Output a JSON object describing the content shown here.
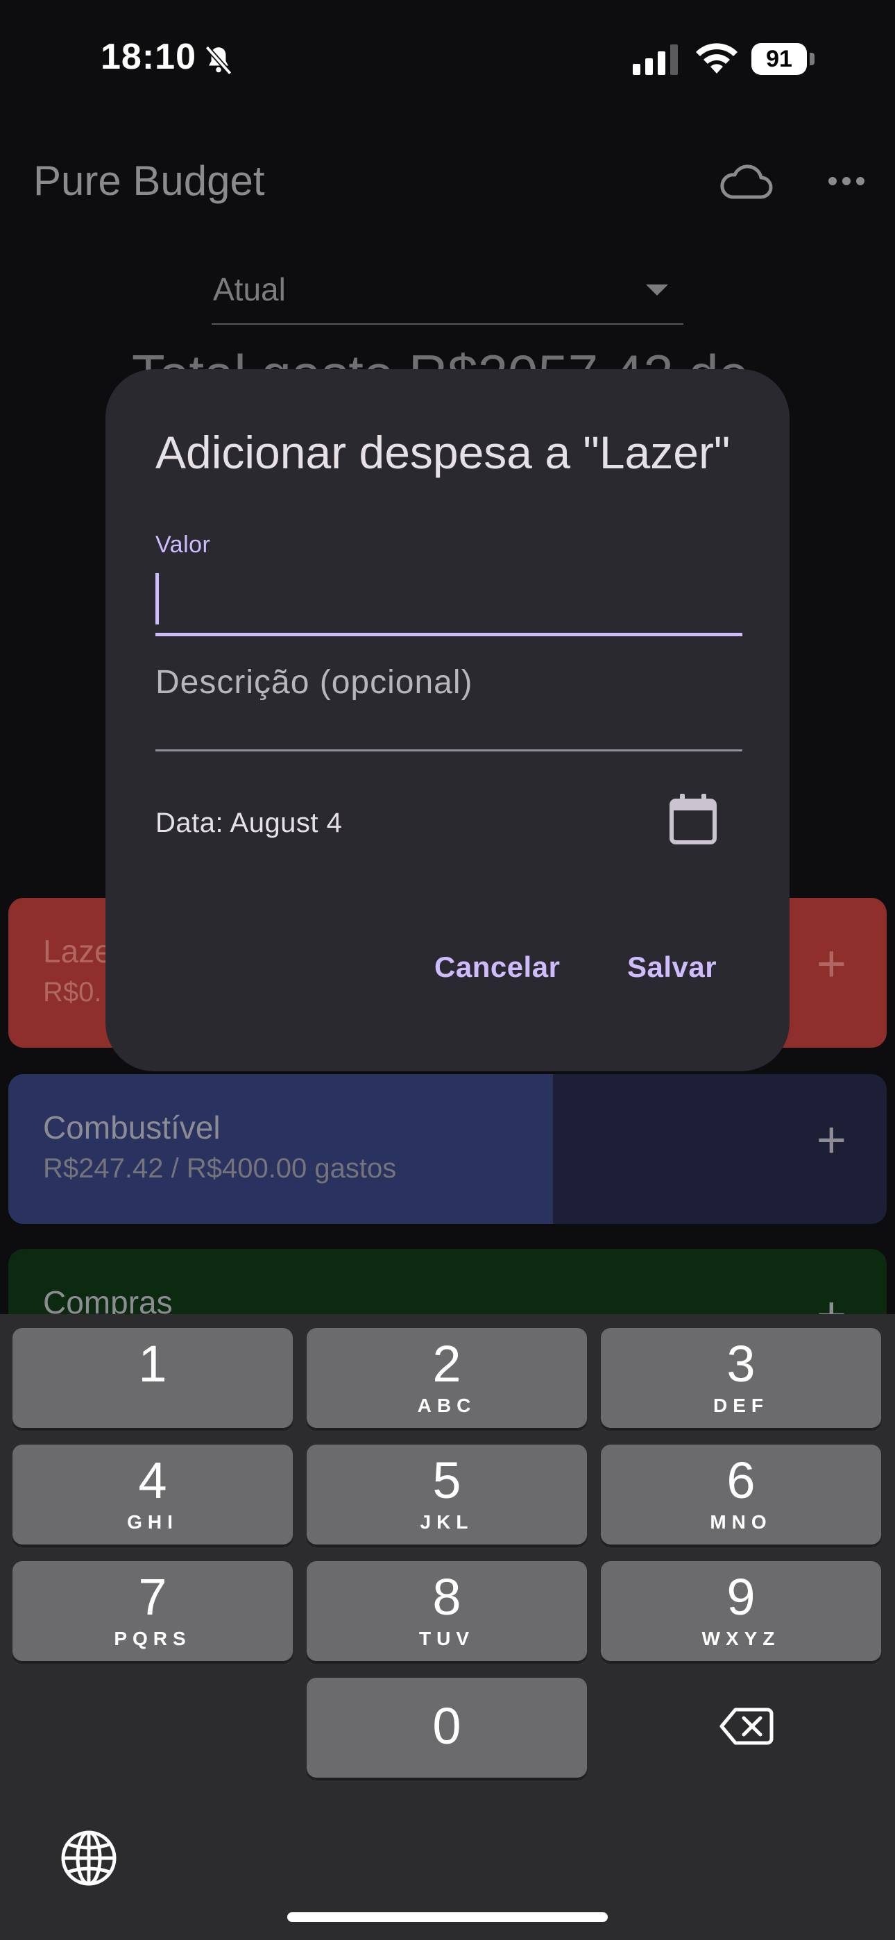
{
  "status_bar": {
    "time": "18:10",
    "battery": "91",
    "icons": [
      "bell-slash-icon",
      "cellular-signal-icon",
      "wifi-icon",
      "battery-icon"
    ]
  },
  "app_bar": {
    "title": "Pure Budget",
    "icons": [
      "cloud-icon",
      "more-horizontal-icon"
    ]
  },
  "period_selector": {
    "value": "Atual"
  },
  "summary": {
    "total_text": "Total gasto R$2057.42 de"
  },
  "categories": [
    {
      "name": "Lazer",
      "amount": "R$0.",
      "plus": "+",
      "color": "#8e2f2b"
    },
    {
      "name": "Combustível",
      "amount": "R$247.42 / R$400.00 gastos",
      "plus": "+",
      "color": "#2a3260",
      "progress": 0.62
    },
    {
      "name": "Compras",
      "plus": "+",
      "color": "#0c2a0f"
    }
  ],
  "dialog": {
    "title": "Adicionar despesa a \"Lazer\"",
    "value_field": {
      "label": "Valor",
      "value": ""
    },
    "description_field": {
      "placeholder": "Descrição (opcional)",
      "value": ""
    },
    "date_text": "Data: August 4",
    "calendar_icon": "calendar-icon",
    "cancel_label": "Cancelar",
    "save_label": "Salvar",
    "accent_color": "#cfbcff",
    "background_color": "#2b2930"
  },
  "keyboard": {
    "keys": [
      {
        "num": "1",
        "letters": ""
      },
      {
        "num": "2",
        "letters": "ABC"
      },
      {
        "num": "3",
        "letters": "DEF"
      },
      {
        "num": "4",
        "letters": "GHI"
      },
      {
        "num": "5",
        "letters": "JKL"
      },
      {
        "num": "6",
        "letters": "MNO"
      },
      {
        "num": "7",
        "letters": "PQRS"
      },
      {
        "num": "8",
        "letters": "TUV"
      },
      {
        "num": "9",
        "letters": "WXYZ"
      },
      {
        "num": "0",
        "letters": ""
      }
    ],
    "backspace_icon": "backspace-icon",
    "globe_icon": "globe-icon"
  }
}
